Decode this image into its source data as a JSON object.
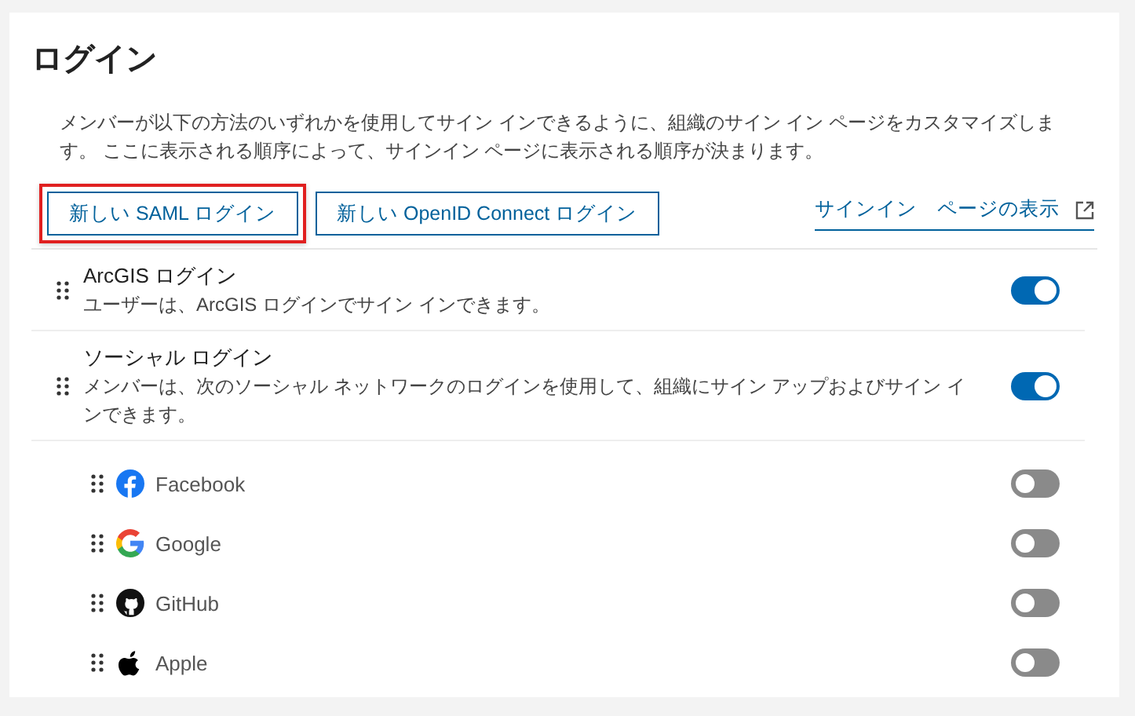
{
  "title": "ログイン",
  "description": "メンバーが以下の方法のいずれかを使用してサイン インできるように、組織のサイン イン ページをカスタマイズします。 ここに表示される順序によって、サインイン ページに表示される順序が決まります。",
  "buttons": [
    {
      "label": "新しい SAML ログイン",
      "highlighted": true
    },
    {
      "label": "新しい OpenID Connect ログイン",
      "highlighted": false
    }
  ],
  "view_link": "サインイン　ページの表示",
  "methods": [
    {
      "name": "ArcGIS ログイン",
      "description": "ユーザーは、ArcGIS ログインでサイン インできます。",
      "on": true
    },
    {
      "name": "ソーシャル ログイン",
      "description": "メンバーは、次のソーシャル ネットワークのログインを使用して、組織にサイン アップおよびサイン インできます。",
      "on": true,
      "children": [
        {
          "name": "Facebook",
          "kind": "facebook",
          "on": false
        },
        {
          "name": "Google",
          "kind": "google",
          "on": false
        },
        {
          "name": "GitHub",
          "kind": "github",
          "on": false
        },
        {
          "name": "Apple",
          "kind": "apple",
          "on": false
        }
      ]
    }
  ]
}
